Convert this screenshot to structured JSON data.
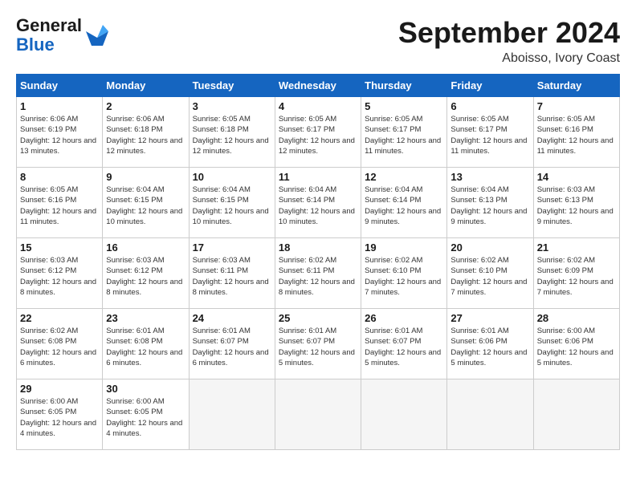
{
  "header": {
    "logo_general": "General",
    "logo_blue": "Blue",
    "month_title": "September 2024",
    "location": "Aboisso, Ivory Coast"
  },
  "days_of_week": [
    "Sunday",
    "Monday",
    "Tuesday",
    "Wednesday",
    "Thursday",
    "Friday",
    "Saturday"
  ],
  "weeks": [
    [
      {
        "day": "1",
        "info": "Sunrise: 6:06 AM\nSunset: 6:19 PM\nDaylight: 12 hours\nand 13 minutes."
      },
      {
        "day": "2",
        "info": "Sunrise: 6:06 AM\nSunset: 6:18 PM\nDaylight: 12 hours\nand 12 minutes."
      },
      {
        "day": "3",
        "info": "Sunrise: 6:05 AM\nSunset: 6:18 PM\nDaylight: 12 hours\nand 12 minutes."
      },
      {
        "day": "4",
        "info": "Sunrise: 6:05 AM\nSunset: 6:17 PM\nDaylight: 12 hours\nand 12 minutes."
      },
      {
        "day": "5",
        "info": "Sunrise: 6:05 AM\nSunset: 6:17 PM\nDaylight: 12 hours\nand 11 minutes."
      },
      {
        "day": "6",
        "info": "Sunrise: 6:05 AM\nSunset: 6:17 PM\nDaylight: 12 hours\nand 11 minutes."
      },
      {
        "day": "7",
        "info": "Sunrise: 6:05 AM\nSunset: 6:16 PM\nDaylight: 12 hours\nand 11 minutes."
      }
    ],
    [
      {
        "day": "8",
        "info": "Sunrise: 6:05 AM\nSunset: 6:16 PM\nDaylight: 12 hours\nand 11 minutes."
      },
      {
        "day": "9",
        "info": "Sunrise: 6:04 AM\nSunset: 6:15 PM\nDaylight: 12 hours\nand 10 minutes."
      },
      {
        "day": "10",
        "info": "Sunrise: 6:04 AM\nSunset: 6:15 PM\nDaylight: 12 hours\nand 10 minutes."
      },
      {
        "day": "11",
        "info": "Sunrise: 6:04 AM\nSunset: 6:14 PM\nDaylight: 12 hours\nand 10 minutes."
      },
      {
        "day": "12",
        "info": "Sunrise: 6:04 AM\nSunset: 6:14 PM\nDaylight: 12 hours\nand 9 minutes."
      },
      {
        "day": "13",
        "info": "Sunrise: 6:04 AM\nSunset: 6:13 PM\nDaylight: 12 hours\nand 9 minutes."
      },
      {
        "day": "14",
        "info": "Sunrise: 6:03 AM\nSunset: 6:13 PM\nDaylight: 12 hours\nand 9 minutes."
      }
    ],
    [
      {
        "day": "15",
        "info": "Sunrise: 6:03 AM\nSunset: 6:12 PM\nDaylight: 12 hours\nand 8 minutes."
      },
      {
        "day": "16",
        "info": "Sunrise: 6:03 AM\nSunset: 6:12 PM\nDaylight: 12 hours\nand 8 minutes."
      },
      {
        "day": "17",
        "info": "Sunrise: 6:03 AM\nSunset: 6:11 PM\nDaylight: 12 hours\nand 8 minutes."
      },
      {
        "day": "18",
        "info": "Sunrise: 6:02 AM\nSunset: 6:11 PM\nDaylight: 12 hours\nand 8 minutes."
      },
      {
        "day": "19",
        "info": "Sunrise: 6:02 AM\nSunset: 6:10 PM\nDaylight: 12 hours\nand 7 minutes."
      },
      {
        "day": "20",
        "info": "Sunrise: 6:02 AM\nSunset: 6:10 PM\nDaylight: 12 hours\nand 7 minutes."
      },
      {
        "day": "21",
        "info": "Sunrise: 6:02 AM\nSunset: 6:09 PM\nDaylight: 12 hours\nand 7 minutes."
      }
    ],
    [
      {
        "day": "22",
        "info": "Sunrise: 6:02 AM\nSunset: 6:08 PM\nDaylight: 12 hours\nand 6 minutes."
      },
      {
        "day": "23",
        "info": "Sunrise: 6:01 AM\nSunset: 6:08 PM\nDaylight: 12 hours\nand 6 minutes."
      },
      {
        "day": "24",
        "info": "Sunrise: 6:01 AM\nSunset: 6:07 PM\nDaylight: 12 hours\nand 6 minutes."
      },
      {
        "day": "25",
        "info": "Sunrise: 6:01 AM\nSunset: 6:07 PM\nDaylight: 12 hours\nand 5 minutes."
      },
      {
        "day": "26",
        "info": "Sunrise: 6:01 AM\nSunset: 6:07 PM\nDaylight: 12 hours\nand 5 minutes."
      },
      {
        "day": "27",
        "info": "Sunrise: 6:01 AM\nSunset: 6:06 PM\nDaylight: 12 hours\nand 5 minutes."
      },
      {
        "day": "28",
        "info": "Sunrise: 6:00 AM\nSunset: 6:06 PM\nDaylight: 12 hours\nand 5 minutes."
      }
    ],
    [
      {
        "day": "29",
        "info": "Sunrise: 6:00 AM\nSunset: 6:05 PM\nDaylight: 12 hours\nand 4 minutes."
      },
      {
        "day": "30",
        "info": "Sunrise: 6:00 AM\nSunset: 6:05 PM\nDaylight: 12 hours\nand 4 minutes."
      },
      {
        "day": "",
        "info": ""
      },
      {
        "day": "",
        "info": ""
      },
      {
        "day": "",
        "info": ""
      },
      {
        "day": "",
        "info": ""
      },
      {
        "day": "",
        "info": ""
      }
    ]
  ]
}
